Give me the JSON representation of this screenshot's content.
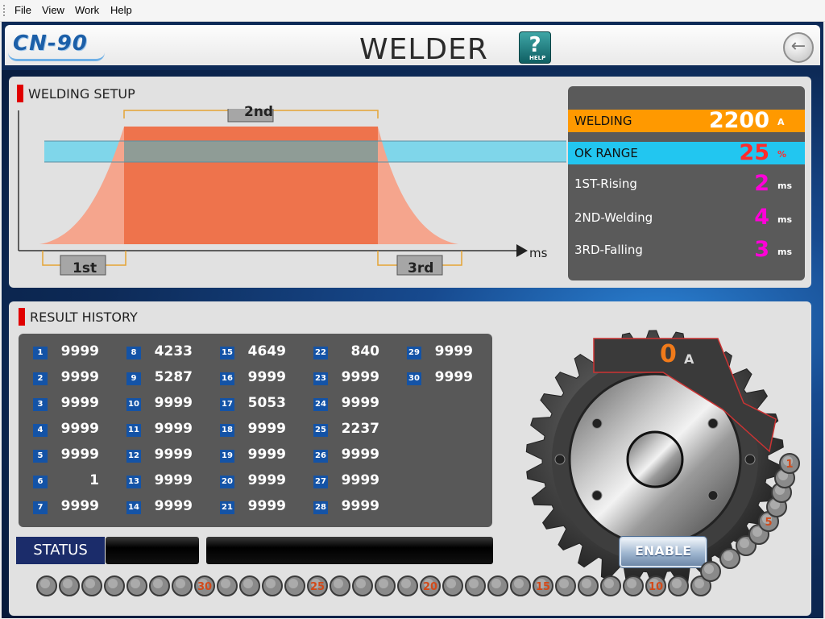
{
  "menu": [
    "File",
    "View",
    "Work",
    "Help"
  ],
  "header": {
    "logo": "CN-90",
    "title": "WELDER",
    "help_icon": "?",
    "help_label": "HELP",
    "back_icon": "←"
  },
  "setup": {
    "title": "WELDING SETUP",
    "chart": {
      "phase1": "1st",
      "phase2": "2nd",
      "phase3": "3rd",
      "x_unit": "ms"
    },
    "params": [
      {
        "label": "WELDING",
        "value": "2200",
        "unit": "A"
      },
      {
        "label": "OK RANGE",
        "value": "25",
        "unit": "%"
      },
      {
        "label": "1ST-Rising",
        "value": "2",
        "unit": "ms"
      },
      {
        "label": "2ND-Welding",
        "value": "4",
        "unit": "ms"
      },
      {
        "label": "3RD-Falling",
        "value": "3",
        "unit": "ms"
      }
    ]
  },
  "history": {
    "title": "RESULT HISTORY",
    "results": [
      {
        "n": "1",
        "v": "9999"
      },
      {
        "n": "2",
        "v": "9999"
      },
      {
        "n": "3",
        "v": "9999"
      },
      {
        "n": "4",
        "v": "9999"
      },
      {
        "n": "5",
        "v": "9999"
      },
      {
        "n": "6",
        "v": "1"
      },
      {
        "n": "7",
        "v": "9999"
      },
      {
        "n": "8",
        "v": "4233"
      },
      {
        "n": "9",
        "v": "5287"
      },
      {
        "n": "10",
        "v": "9999"
      },
      {
        "n": "11",
        "v": "9999"
      },
      {
        "n": "12",
        "v": "9999"
      },
      {
        "n": "13",
        "v": "9999"
      },
      {
        "n": "14",
        "v": "9999"
      },
      {
        "n": "15",
        "v": "4649"
      },
      {
        "n": "16",
        "v": "9999"
      },
      {
        "n": "17",
        "v": "5053"
      },
      {
        "n": "18",
        "v": "9999"
      },
      {
        "n": "19",
        "v": "9999"
      },
      {
        "n": "20",
        "v": "9999"
      },
      {
        "n": "21",
        "v": "9999"
      },
      {
        "n": "22",
        "v": "840"
      },
      {
        "n": "23",
        "v": "9999"
      },
      {
        "n": "24",
        "v": "9999"
      },
      {
        "n": "25",
        "v": "2237"
      },
      {
        "n": "26",
        "v": "9999"
      },
      {
        "n": "27",
        "v": "9999"
      },
      {
        "n": "28",
        "v": "9999"
      },
      {
        "n": "29",
        "v": "9999"
      },
      {
        "n": "30",
        "v": "9999"
      }
    ],
    "status_label": "STATUS",
    "amp_value": "0",
    "amp_unit": "A",
    "enable_label": "ENABLE",
    "dot_labels": [
      "1",
      "5",
      "10",
      "15",
      "20",
      "25",
      "30"
    ]
  },
  "colors": {
    "welding_bg": "#ff9900",
    "ok_bg": "#22c6f0",
    "value_red": "#ff2b2b",
    "value_magenta": "#ff00d8",
    "status_bg": "#1b2c6a"
  }
}
